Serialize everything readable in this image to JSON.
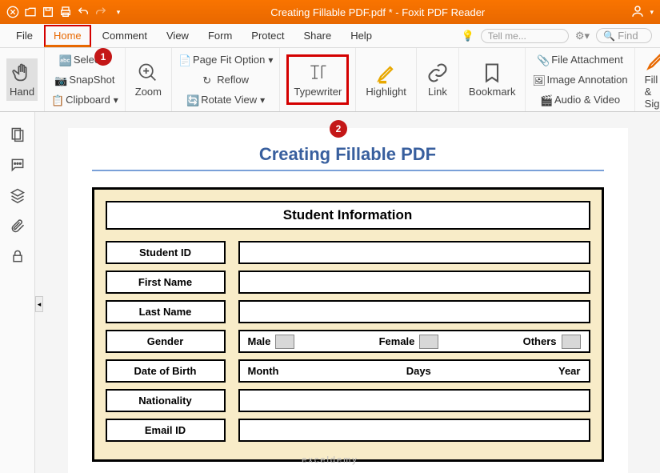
{
  "titlebar": {
    "filename": "Creating Fillable PDF.pdf *",
    "app": "Foxit PDF Reader"
  },
  "menu": {
    "file": "File",
    "home": "Home",
    "comment": "Comment",
    "view": "View",
    "form": "Form",
    "protect": "Protect",
    "share": "Share",
    "help": "Help",
    "tellme": "Tell me...",
    "find": "Find"
  },
  "ribbon": {
    "hand": "Hand",
    "select": "Select",
    "snapshot": "SnapShot",
    "clipboard": "Clipboard",
    "zoom": "Zoom",
    "pagefit": "Page Fit Option",
    "reflow": "Reflow",
    "rotate": "Rotate View",
    "typewriter": "Typewriter",
    "highlight": "Highlight",
    "link": "Link",
    "bookmark": "Bookmark",
    "fileattach": "File Attachment",
    "imageannot": "Image Annotation",
    "audiovideo": "Audio & Video",
    "fillsign": "Fill & Sign"
  },
  "badges": {
    "b1": "1",
    "b2": "2"
  },
  "page": {
    "title": "Creating Fillable PDF",
    "section": "Student Information",
    "rows": {
      "studentid": "Student ID",
      "firstname": "First Name",
      "lastname": "Last Name",
      "gender": "Gender",
      "dob": "Date of Birth",
      "nationality": "Nationality",
      "email": "Email ID"
    },
    "gender": {
      "male": "Male",
      "female": "Female",
      "others": "Others"
    },
    "dob": {
      "month": "Month",
      "days": "Days",
      "year": "Year"
    }
  },
  "watermark": "exceldemy"
}
